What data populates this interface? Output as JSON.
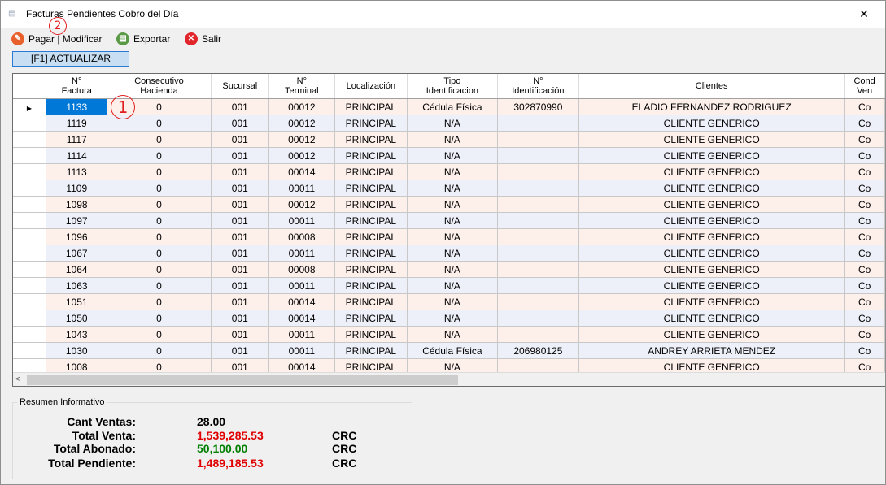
{
  "window": {
    "title": "Facturas Pendientes Cobro del Día",
    "min_icon": "minimize-icon",
    "max_icon": "maximize-icon",
    "close_icon": "close-icon"
  },
  "toolbar": {
    "pagar_label": "Pagar | Modificar",
    "exportar_label": "Exportar",
    "salir_label": "Salir",
    "actualizar_label": "[F1] ACTUALIZAR"
  },
  "callouts": {
    "one": "1",
    "two": "2"
  },
  "grid": {
    "columns": [
      "N°\nFactura",
      "Consecutivo\nHacienda",
      "Sucursal",
      "N°\nTerminal",
      "Localización",
      "Tipo\nIdentificacion",
      "N°\nIdentificación",
      "Clientes",
      "Cond\nVen"
    ],
    "rows": [
      [
        "1133",
        "0",
        "001",
        "00012",
        "PRINCIPAL",
        "Cédula Física",
        "302870990",
        "ELADIO FERNANDEZ RODRIGUEZ",
        "Co"
      ],
      [
        "1119",
        "0",
        "001",
        "00012",
        "PRINCIPAL",
        "N/A",
        "",
        "CLIENTE GENERICO",
        "Co"
      ],
      [
        "1117",
        "0",
        "001",
        "00012",
        "PRINCIPAL",
        "N/A",
        "",
        "CLIENTE GENERICO",
        "Co"
      ],
      [
        "1114",
        "0",
        "001",
        "00012",
        "PRINCIPAL",
        "N/A",
        "",
        "CLIENTE GENERICO",
        "Co"
      ],
      [
        "1113",
        "0",
        "001",
        "00014",
        "PRINCIPAL",
        "N/A",
        "",
        "CLIENTE GENERICO",
        "Co"
      ],
      [
        "1109",
        "0",
        "001",
        "00011",
        "PRINCIPAL",
        "N/A",
        "",
        "CLIENTE GENERICO",
        "Co"
      ],
      [
        "1098",
        "0",
        "001",
        "00012",
        "PRINCIPAL",
        "N/A",
        "",
        "CLIENTE GENERICO",
        "Co"
      ],
      [
        "1097",
        "0",
        "001",
        "00011",
        "PRINCIPAL",
        "N/A",
        "",
        "CLIENTE GENERICO",
        "Co"
      ],
      [
        "1096",
        "0",
        "001",
        "00008",
        "PRINCIPAL",
        "N/A",
        "",
        "CLIENTE GENERICO",
        "Co"
      ],
      [
        "1067",
        "0",
        "001",
        "00011",
        "PRINCIPAL",
        "N/A",
        "",
        "CLIENTE GENERICO",
        "Co"
      ],
      [
        "1064",
        "0",
        "001",
        "00008",
        "PRINCIPAL",
        "N/A",
        "",
        "CLIENTE GENERICO",
        "Co"
      ],
      [
        "1063",
        "0",
        "001",
        "00011",
        "PRINCIPAL",
        "N/A",
        "",
        "CLIENTE GENERICO",
        "Co"
      ],
      [
        "1051",
        "0",
        "001",
        "00014",
        "PRINCIPAL",
        "N/A",
        "",
        "CLIENTE GENERICO",
        "Co"
      ],
      [
        "1050",
        "0",
        "001",
        "00014",
        "PRINCIPAL",
        "N/A",
        "",
        "CLIENTE GENERICO",
        "Co"
      ],
      [
        "1043",
        "0",
        "001",
        "00011",
        "PRINCIPAL",
        "N/A",
        "",
        "CLIENTE GENERICO",
        "Co"
      ],
      [
        "1030",
        "0",
        "001",
        "00011",
        "PRINCIPAL",
        "Cédula Física",
        "206980125",
        "ANDREY ARRIETA MENDEZ",
        "Co"
      ],
      [
        "1008",
        "0",
        "001",
        "00014",
        "PRINCIPAL",
        "N/A",
        "",
        "CLIENTE GENERICO",
        "Co"
      ]
    ]
  },
  "resumen": {
    "title": "Resumen Informativo",
    "cant_ventas_label": "Cant Ventas:",
    "cant_ventas_value": "28.00",
    "total_venta_label": "Total Venta:",
    "total_venta_value": "1,539,285.53",
    "total_abonado_label": "Total Abonado:",
    "total_abonado_value": "50,100.00",
    "total_pendiente_label": "Total Pendiente:",
    "total_pendiente_value": "1,489,185.53",
    "currency": "CRC",
    "colors": {
      "venta": "#e00000",
      "abonado": "#008000",
      "pendiente": "#e00000"
    }
  }
}
